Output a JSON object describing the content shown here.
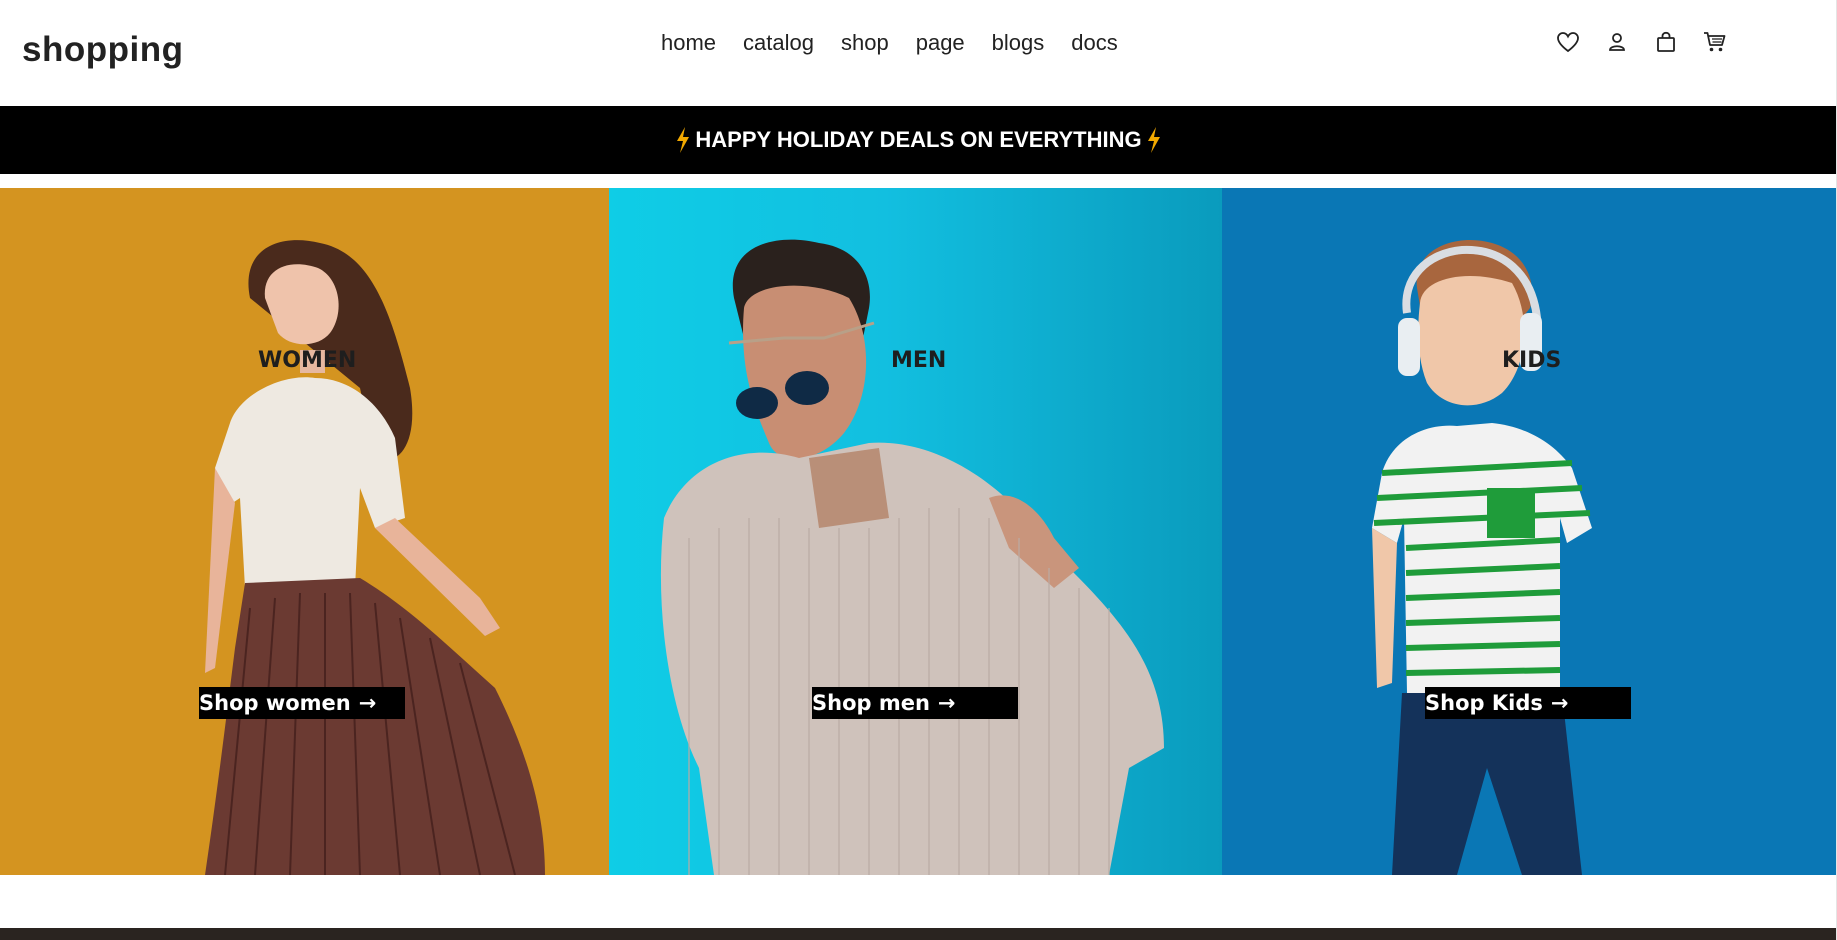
{
  "header": {
    "logo": "shopping",
    "nav": [
      "home",
      "catalog",
      "shop",
      "page",
      "blogs",
      "docs"
    ],
    "icons": [
      "heart-icon",
      "user-icon",
      "bag-icon",
      "cart-icon"
    ]
  },
  "banner": {
    "text": "HAPPY HOLIDAY DEALS ON EVERYTHING",
    "accent": "#f2a900"
  },
  "categories": [
    {
      "label": "WOMEN",
      "button": "Shop women",
      "bg": "#d49420"
    },
    {
      "label": "MEN",
      "button": "Shop men",
      "bg": "#10c3e0"
    },
    {
      "label": "KIDS",
      "button": "Shop Kids",
      "bg": "#0a77b5"
    }
  ]
}
